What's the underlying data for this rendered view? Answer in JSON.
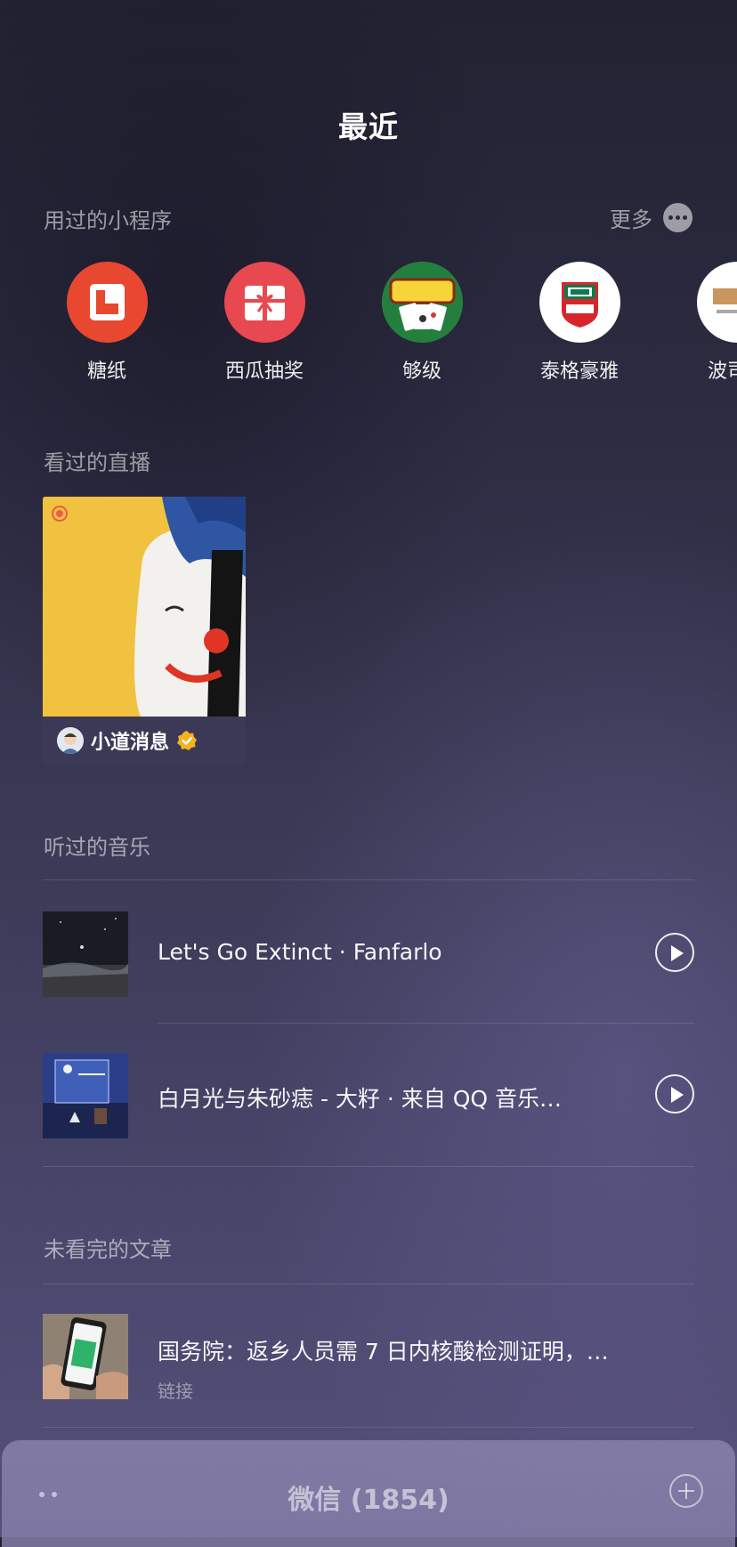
{
  "page": {
    "title": "最近"
  },
  "mini_programs": {
    "section_label": "用过的小程序",
    "more_label": "更多",
    "items": [
      {
        "label": "糖纸",
        "icon": "tangzhi-logo-icon",
        "color": "#e8482f"
      },
      {
        "label": "西瓜抽奖",
        "icon": "gift-box-icon",
        "color": "#e8484f"
      },
      {
        "label": "够级",
        "icon": "gouji-card-game-icon",
        "color": "#1f7a3c"
      },
      {
        "label": "泰格豪雅",
        "icon": "tag-heuer-logo-icon",
        "color": "#ffffff"
      },
      {
        "label": "波司登",
        "icon": "bosideng-logo-icon",
        "color": "#ffffff"
      }
    ]
  },
  "live": {
    "section_label": "看过的直播",
    "items": [
      {
        "name": "小道消息",
        "verified": true
      }
    ]
  },
  "music": {
    "section_label": "听过的音乐",
    "items": [
      {
        "title": "Let's Go Extinct · Fanfarlo"
      },
      {
        "title": "白月光与朱砂痣 - 大籽 · 来自 QQ 音乐…"
      }
    ]
  },
  "articles": {
    "section_label": "未看完的文章",
    "items": [
      {
        "title": "国务院：返乡人员需 7 日内核酸检测证明，…",
        "type": "链接"
      }
    ]
  },
  "bottom_bar": {
    "title": "微信 (1854)"
  },
  "colors": {
    "live_badge": "#ef5a49",
    "verified_badge": "#f5b21b"
  }
}
